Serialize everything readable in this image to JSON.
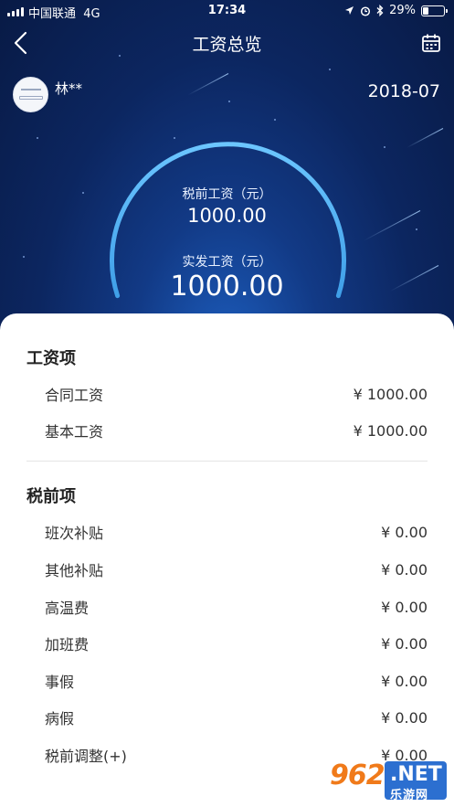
{
  "status_bar": {
    "carrier": "中国联通",
    "network": "4G",
    "time": "17:34",
    "battery": "29%"
  },
  "nav": {
    "title": "工资总览",
    "back_icon": "chevron-left-icon",
    "calendar_icon": "calendar-icon"
  },
  "user": {
    "name": "林**",
    "period": "2018-07"
  },
  "summary": {
    "pre_tax_label": "税前工资（元）",
    "pre_tax_value": "1000.00",
    "net_label": "实发工资（元）",
    "net_value": "1000.00"
  },
  "sections": {
    "salary": {
      "title": "工资项",
      "items": [
        {
          "label": "合同工资",
          "value": "¥ 1000.00"
        },
        {
          "label": "基本工资",
          "value": "¥ 1000.00"
        }
      ]
    },
    "pretax": {
      "title": "税前项",
      "items": [
        {
          "label": "班次补贴",
          "value": "¥ 0.00"
        },
        {
          "label": "其他补贴",
          "value": "¥ 0.00"
        },
        {
          "label": "高温费",
          "value": "¥ 0.00"
        },
        {
          "label": "加班费",
          "value": "¥ 0.00"
        },
        {
          "label": "事假",
          "value": "¥ 0.00"
        },
        {
          "label": "病假",
          "value": "¥ 0.00"
        },
        {
          "label": "税前调整(+)",
          "value": "¥ 0.00"
        }
      ]
    }
  },
  "watermark": {
    "logo": "962",
    "suffix": ".NET",
    "sub": "乐游网"
  },
  "colors": {
    "hero_dark": "#081a45",
    "hero_mid": "#123a86",
    "arc": "#4fb2f5",
    "watermark_orange": "#f07a1a"
  }
}
